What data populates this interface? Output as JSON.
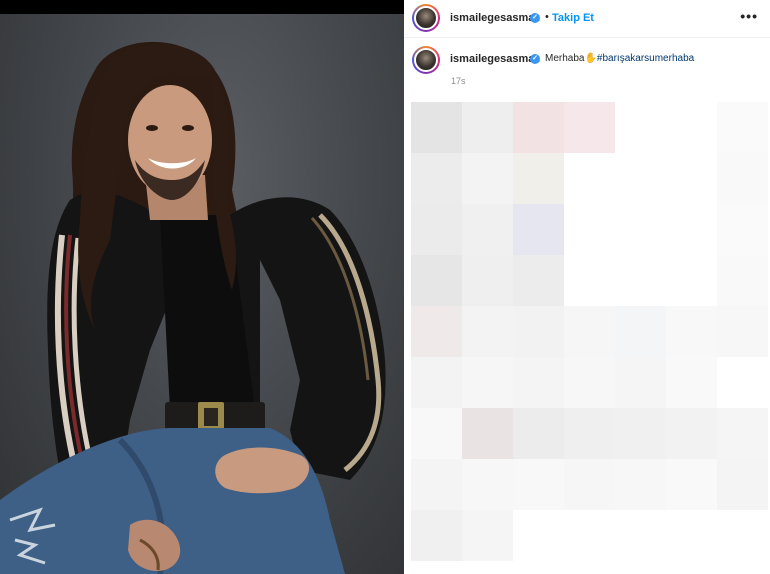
{
  "header": {
    "username": "ismailegesasmaz",
    "separator": "•",
    "follow_label": "Takip Et",
    "more_label": "•••",
    "verified_mark": "✓"
  },
  "caption": {
    "username": "ismailegesasmaz",
    "text": "Merhaba",
    "hand_emoji": "✋",
    "hashtag": "#barışakarsumerhaba",
    "time": "17s",
    "verified_mark": "✓"
  },
  "colors": {
    "follow": "#0095f6",
    "verified": "#3897f0",
    "hashtag": "#00376b"
  },
  "icons": [
    "verified-badge-icon",
    "more-options-icon",
    "waving-hand-icon"
  ]
}
